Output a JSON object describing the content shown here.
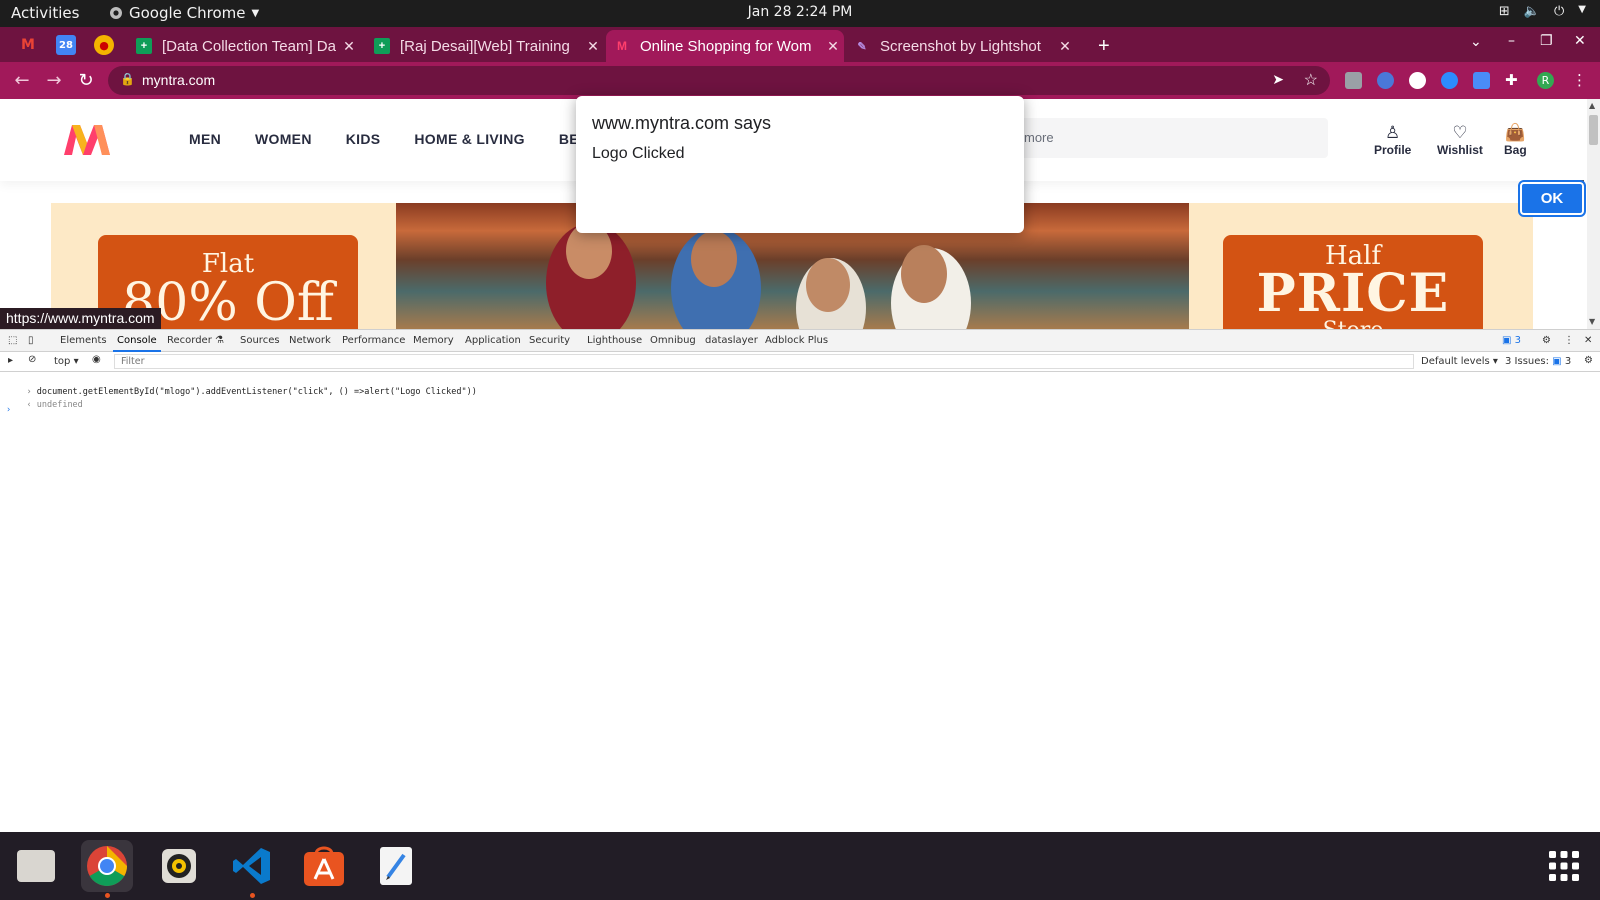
{
  "system": {
    "activities": "Activities",
    "app_name": "Google Chrome",
    "clock": "Jan 28  2:24 PM"
  },
  "tabs": [
    {
      "label": "[Data Collection Team] Da",
      "icon": "sheets-icon"
    },
    {
      "label": "[Raj Desai][Web] Training",
      "icon": "sheets-icon"
    },
    {
      "label": "Online Shopping for Wom",
      "icon": "myntra-icon",
      "active": true
    },
    {
      "label": "Screenshot by Lightshot",
      "icon": "feather-icon"
    }
  ],
  "omnibox": {
    "url": "myntra.com"
  },
  "site": {
    "nav": [
      "MEN",
      "WOMEN",
      "KIDS",
      "HOME & LIVING",
      "BEAU"
    ],
    "search_placeholder": "more",
    "profile": "Profile",
    "wishlist": "Wishlist",
    "bag": "Bag",
    "promo_left_1": "Flat",
    "promo_left_2": "80% Off",
    "promo_right_1": "Half",
    "promo_right_2": "PRICE",
    "promo_right_3": "Store",
    "status_url": "https://www.myntra.com"
  },
  "devtools": {
    "tabs": [
      "Elements",
      "Console",
      "Recorder ⚗",
      "Sources",
      "Network",
      "Performance",
      "Memory",
      "Application",
      "Security",
      "Lighthouse",
      "Omnibug",
      "dataslayer",
      "Adblock Plus"
    ],
    "badge_count": "3",
    "context": "top ▾",
    "filter_placeholder": "Filter",
    "default_levels": "Default levels ▾",
    "issues": "3 Issues:",
    "issues_count": "3",
    "console_input": "document.getElementById(\"mlogo\").addEventListener(\"click\", () =>alert(\"Logo Clicked\"))",
    "console_result": "undefined"
  },
  "dialog": {
    "title": "www.myntra.com says",
    "message": "Logo Clicked",
    "ok": "OK"
  },
  "colors": {
    "tabstrip": "#6e1340",
    "omnibar": "#a1195a",
    "accent_blue": "#1a73e8"
  }
}
